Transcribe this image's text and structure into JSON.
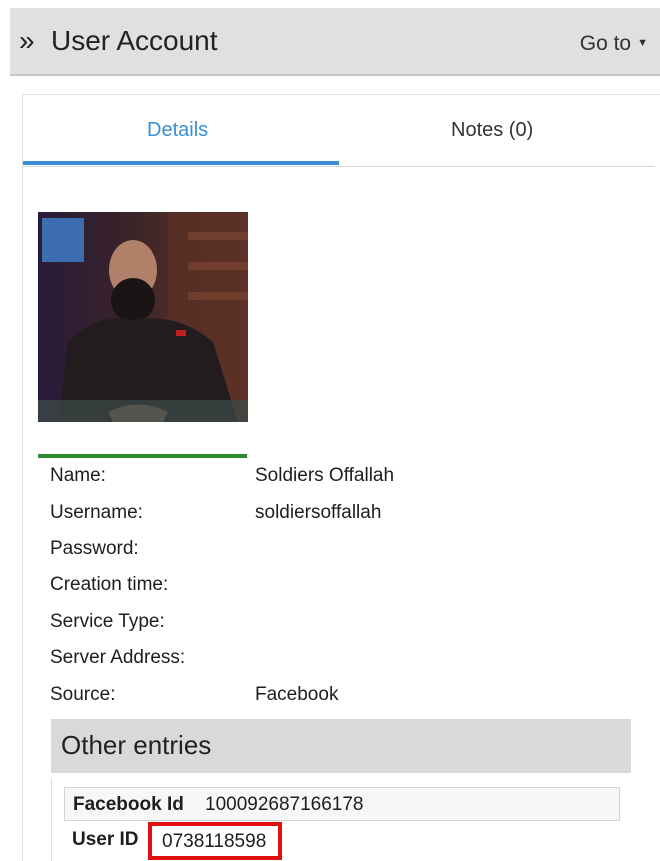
{
  "header": {
    "title": "User Account",
    "goto_label": "Go to"
  },
  "tabs": [
    {
      "label": "Details",
      "active": true
    },
    {
      "label": "Notes (0)",
      "active": false
    }
  ],
  "fields": [
    {
      "label": "Name:",
      "value": "Soldiers Offallah"
    },
    {
      "label": "Username:",
      "value": "soldiersoffallah"
    },
    {
      "label": "Password:",
      "value": ""
    },
    {
      "label": "Creation time:",
      "value": ""
    },
    {
      "label": "Service Type:",
      "value": ""
    },
    {
      "label": "Server Address:",
      "value": ""
    },
    {
      "label": "Source:",
      "value": "Facebook"
    }
  ],
  "other_entries": {
    "title": "Other entries",
    "facebook_id_label": "Facebook Id",
    "facebook_id_value": "100092687166178",
    "user_id_label": "User ID",
    "user_id_value": "0738118598"
  },
  "colors": {
    "accent": "#3a8fd6",
    "photo_underline": "#2e8b2e",
    "highlight_box": "#e01010"
  }
}
